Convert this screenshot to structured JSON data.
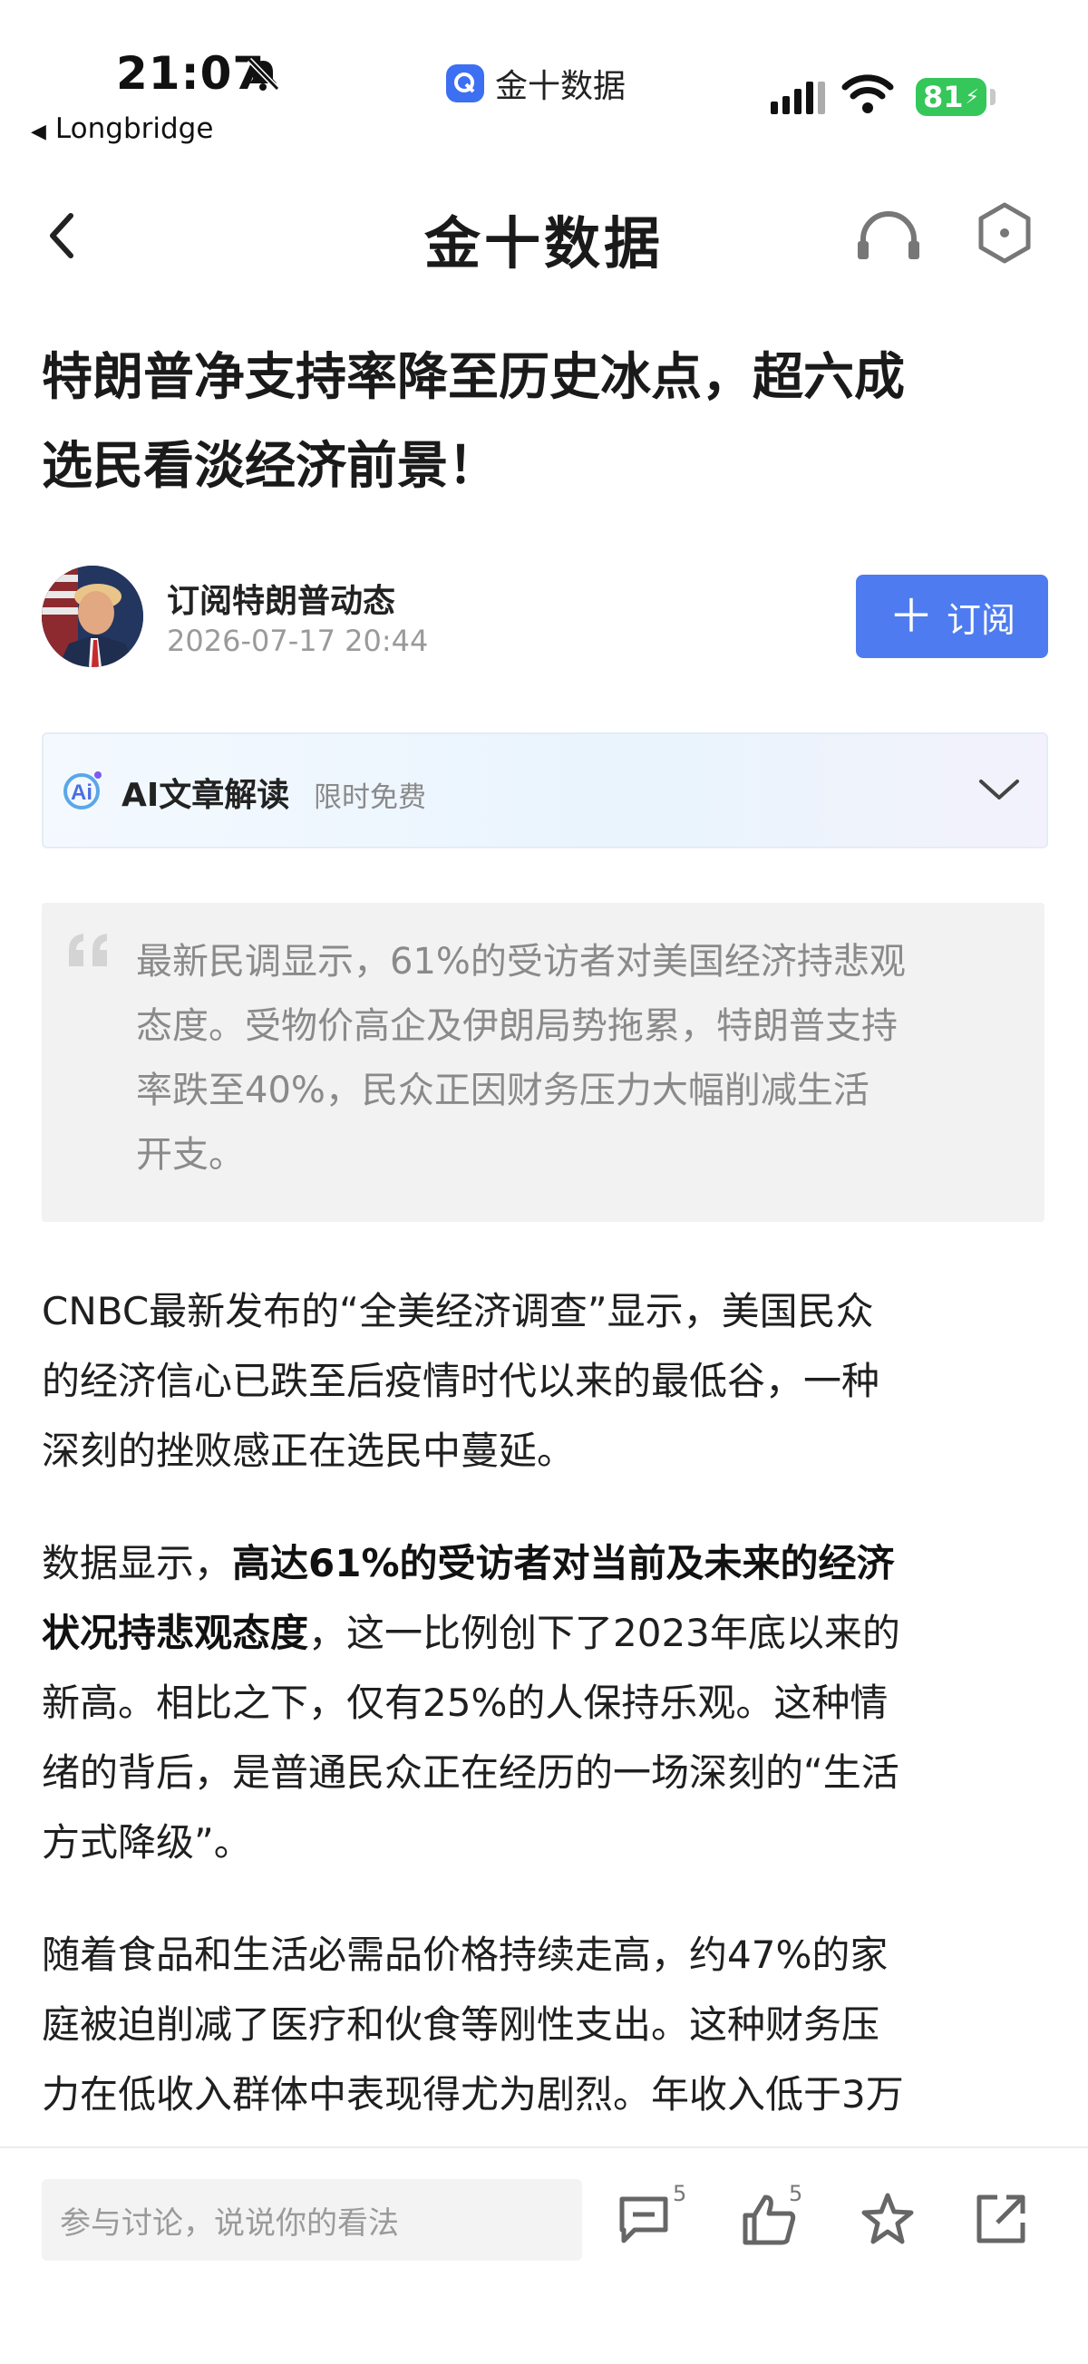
{
  "status_bar": {
    "time": "21:07",
    "back_app": "Longbridge",
    "center_app": "金十数据",
    "battery": "81"
  },
  "nav": {
    "title": "金十数据"
  },
  "article": {
    "title_line1": "特朗普净支持率降至历史冰点，超六成",
    "title_line2": "选民看淡经济前景！",
    "author": "订阅特朗普动态",
    "date": "2026-07-17 20:44",
    "subscribe_label": "订阅",
    "ai": {
      "label": "AI文章解读",
      "tag": "限时免费"
    },
    "summary_lines": [
      "最新民调显示，61%的受访者对美国经济持悲观",
      "态度。受物价高企及伊朗局势拖累，特朗普支持",
      "率跌至40%，民众正因财务压力大幅削减生活",
      "开支。"
    ],
    "p1_lines": [
      "CNBC最新发布的“全美经济调查”显示，美国民众",
      "的经济信心已跌至后疫情时代以来的最低谷，一种",
      "深刻的挫败感正在选民中蔓延。"
    ],
    "p2": {
      "l1_prefix": "数据显示，",
      "l1_bold": "高达61%的受访者对当前及未来的经济",
      "l2_bold": "状况持悲观态度",
      "l2_rest": "，这一比例创下了2023年底以来的",
      "l3": "新高。相比之下，仅有25%的人保持乐观。这种情",
      "l4": "绪的背后，是普通民众正在经历的一场深刻的“生活",
      "l5": "方式降级”。"
    },
    "p3_lines": [
      "随着食品和生活必需品价格持续走高，约47%的家",
      "庭被迫削减了医疗和伙食等刚性支出。这种财务压",
      "力在低收入群体中表现得尤为剧烈。年收入低于3万"
    ]
  },
  "bottom_bar": {
    "comment_placeholder": "参与讨论，说说你的看法",
    "comment_count": "5",
    "like_count": "5"
  },
  "colors": {
    "accent": "#4e7cf0",
    "battery": "#35c759"
  },
  "icons": [
    "bell-slash-icon",
    "app-icon",
    "signal-icon",
    "wifi-icon",
    "battery-icon",
    "back-arrow-icon",
    "headphone-icon",
    "hexagon-icon",
    "ai-logo-icon",
    "chevron-down-icon",
    "quote-icon",
    "comment-icon",
    "thumb-up-icon",
    "star-icon",
    "share-icon"
  ]
}
